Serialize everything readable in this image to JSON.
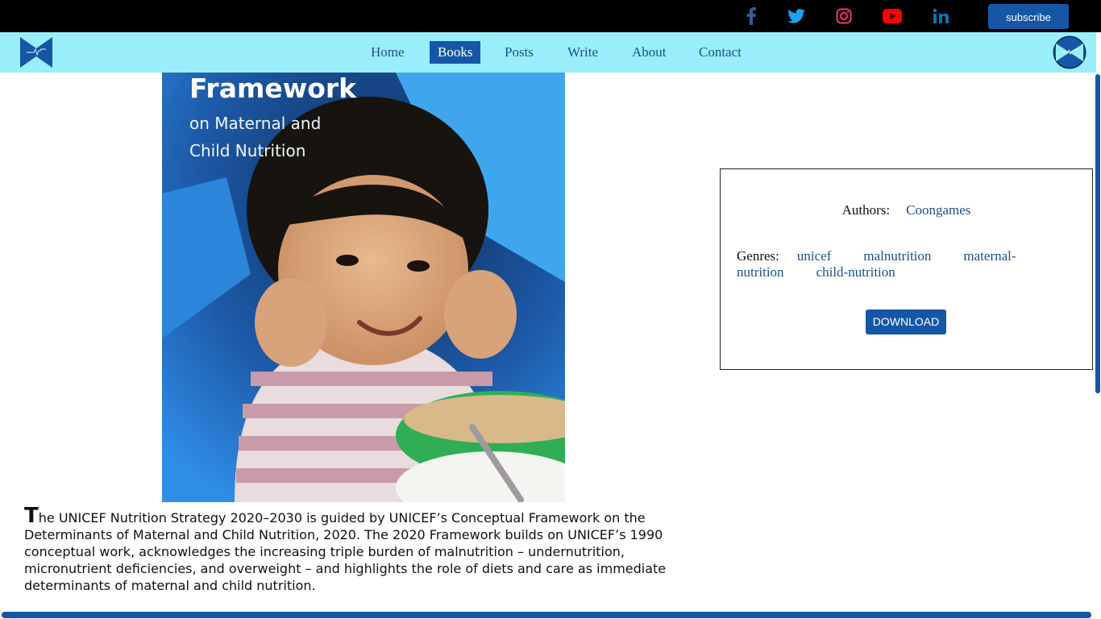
{
  "social": [
    {
      "icon": "facebook-icon",
      "color": "#3b5998"
    },
    {
      "icon": "twitter-icon",
      "color": "#1da1f2"
    },
    {
      "icon": "instagram-icon",
      "color": "#e1306c"
    },
    {
      "icon": "youtube-icon",
      "color": "#ff0000"
    },
    {
      "icon": "linkedin-icon",
      "color": "#0077b5"
    }
  ],
  "subscribe_label": "subscribe",
  "nav": {
    "items": [
      "Home",
      "Books",
      "Posts",
      "Write",
      "About",
      "Contact"
    ],
    "active": "Books"
  },
  "book": {
    "cover_title": "Framework",
    "cover_subtitle": "on Maternal and Child Nutrition",
    "description_initial": "T",
    "description_rest": "he UNICEF Nutrition Strategy 2020–2030 is guided by UNICEF’s Conceptual Framework on the Determinants of Maternal and Child Nutrition, 2020. The 2020 Framework builds on UNICEF’s 1990 conceptual work, acknowledges the increasing triple burden of malnutrition – undernutrition, micronutrient deficiencies, and overweight – and highlights the role of diets and care as immediate determinants of maternal and child nutrition.",
    "authors_label": "Authors:",
    "authors": [
      "Coongames"
    ],
    "genres_label": "Genres:",
    "genres": [
      "unicef",
      "malnutrition",
      "maternal-nutrition",
      "child-nutrition"
    ],
    "download_label": "DOWNLOAD"
  },
  "colors": {
    "topbar": "#000000",
    "navbar": "#9aeefc",
    "accent": "#1557a6",
    "link": "#1d4f8a"
  }
}
